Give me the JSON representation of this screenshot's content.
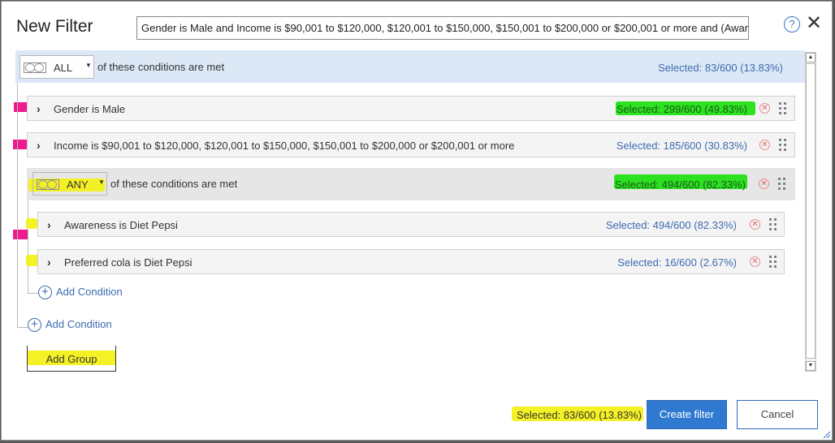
{
  "dialog": {
    "title": "New Filter",
    "filter_summary": "Gender is Male and Income is $90,001 to $120,000, $120,001 to $150,000, $150,001 to $200,000 or $200,001 or more and (Aware",
    "help_icon": "?",
    "close_icon": "✕"
  },
  "root_group": {
    "operator": "ALL",
    "label": "of these conditions are met",
    "selected": "Selected: 83/600 (13.83%)"
  },
  "conditions": [
    {
      "label": "Gender is Male",
      "selected": "Selected: 299/600 (49.83%)"
    },
    {
      "label": "Income is $90,001 to $120,000, $120,001 to $150,000, $150,001 to $200,000 or $200,001 or more",
      "selected": "Selected: 185/600 (30.83%)"
    }
  ],
  "sub_group": {
    "operator": "ANY",
    "label": "of these conditions are met",
    "selected": "Selected: 494/600 (82.33%)",
    "conditions": [
      {
        "label": "Awareness is Diet Pepsi",
        "selected": "Selected: 494/600 (82.33%)"
      },
      {
        "label": "Preferred cola is Diet Pepsi",
        "selected": "Selected: 16/600 (2.67%)"
      }
    ],
    "add_condition": "Add Condition"
  },
  "add_condition": "Add Condition",
  "add_group": "Add Group",
  "footer": {
    "selected": "Selected: 83/600 (13.83%)",
    "create_button": "Create filter",
    "cancel_button": "Cancel"
  },
  "icons": {
    "chevron": "chevron-right-icon",
    "remove": "remove-circle-icon",
    "drag": "drag-handle-icon",
    "plus": "plus-circle-icon"
  },
  "colors": {
    "accent": "#2f7ad0",
    "link": "#3d6bb0",
    "group_bg": "#dce8f6",
    "highlight_pink": "#ee1a8e",
    "highlight_green": "#22e014",
    "highlight_yellow": "#f3f11a"
  }
}
